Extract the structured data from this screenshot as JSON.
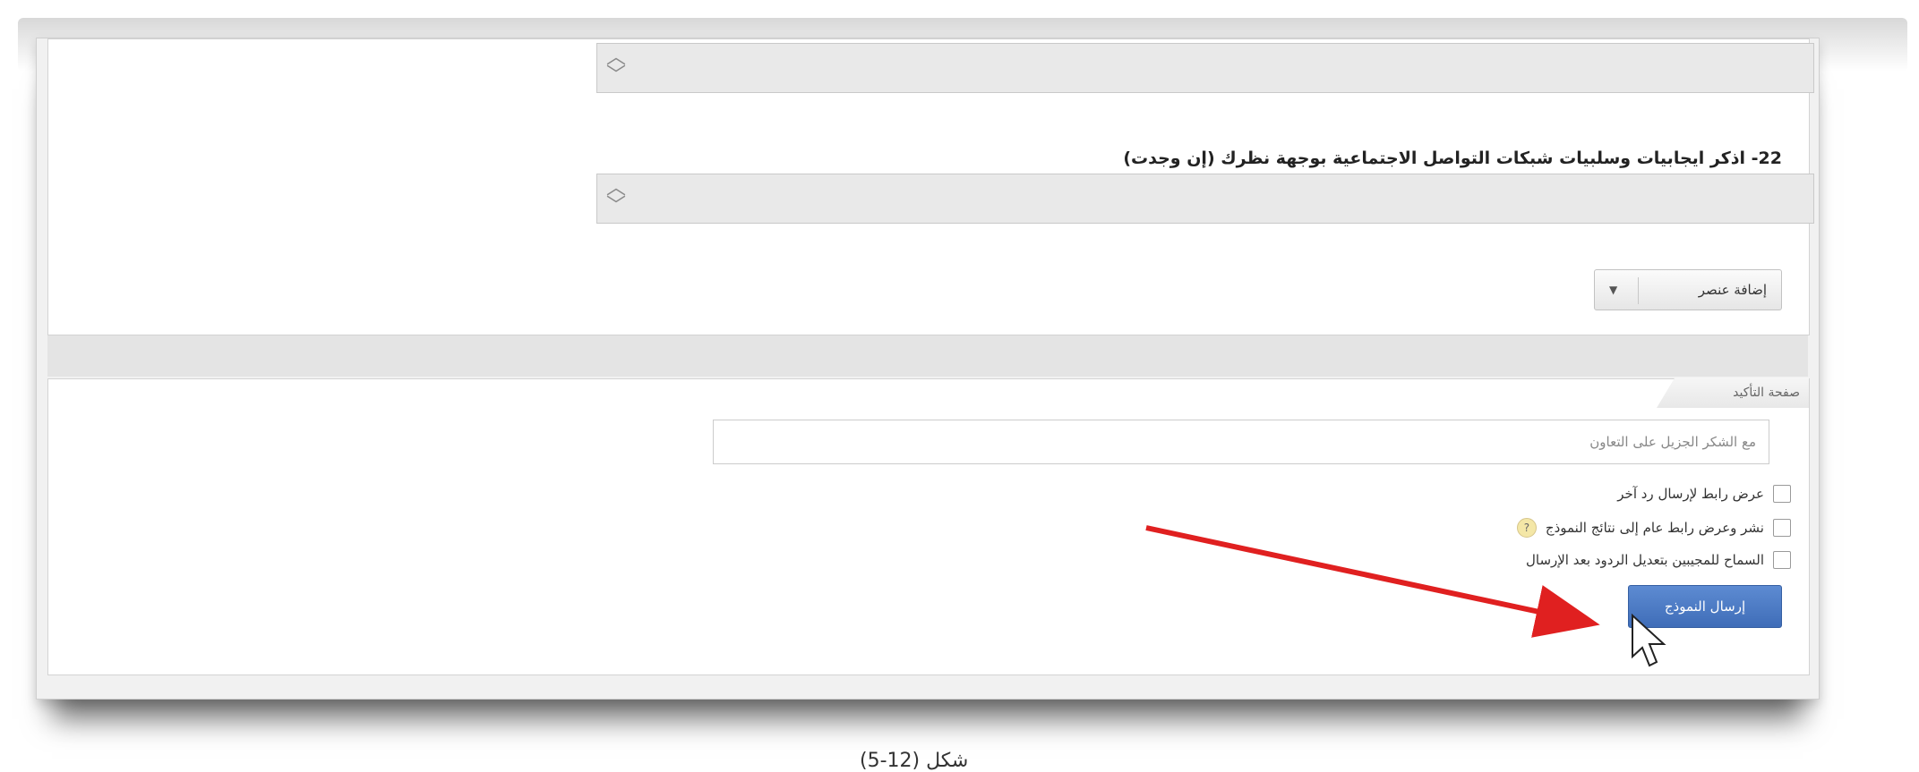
{
  "form": {
    "question_22": "22- اذكر ايجابيات وسلبيات شبكات التواصل الاجتماعية بوجهة نظرك (إن وجدت)",
    "add_item_label": "إضافة عنصر",
    "confirmation_tab_label": "صفحة التأكيد",
    "confirmation_message": "مع الشكر الجزيل على التعاون",
    "options": [
      {
        "label": "عرض رابط لإرسال رد آخر",
        "checked": false,
        "help": false
      },
      {
        "label": "نشر وعرض رابط عام إلى نتائج النموذج",
        "checked": false,
        "help": true
      },
      {
        "label": "السماح للمجيبين بتعديل الردود بعد الإرسال",
        "checked": false,
        "help": false
      }
    ],
    "submit_label": "إرسال النموذج",
    "help_symbol": "?"
  },
  "caption": "شكل (12-5)",
  "colors": {
    "arrow": "#e02020",
    "submit": "#4a78c2"
  }
}
